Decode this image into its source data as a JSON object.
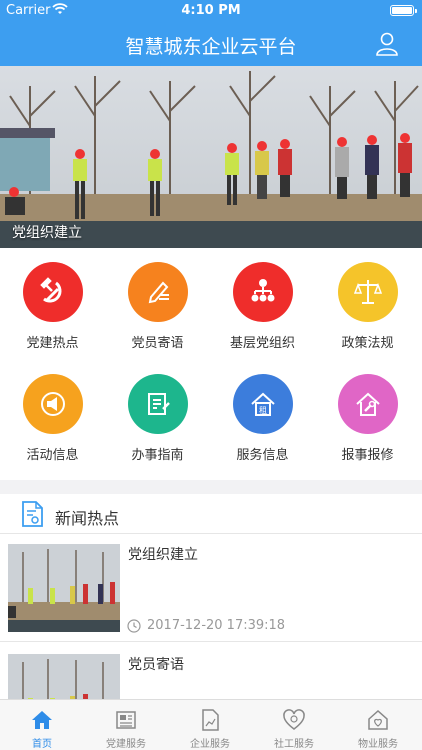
{
  "status_bar": {
    "carrier": "Carrier",
    "time": "4:10 PM"
  },
  "nav": {
    "title": "智慧城东企业云平台",
    "user_icon": "user-icon"
  },
  "banner": {
    "caption": "党组织建立"
  },
  "grid": {
    "items": [
      {
        "label": "党建热点",
        "icon": "hammer-sickle-icon",
        "color": "#ef2d2b"
      },
      {
        "label": "党员寄语",
        "icon": "pen-note-icon",
        "color": "#f6821e"
      },
      {
        "label": "基层党组织",
        "icon": "org-chart-icon",
        "color": "#ef2d2b"
      },
      {
        "label": "政策法规",
        "icon": "scales-icon",
        "color": "#f5c42a"
      },
      {
        "label": "活动信息",
        "icon": "megaphone-icon",
        "color": "#f6a21e"
      },
      {
        "label": "办事指南",
        "icon": "guide-icon",
        "color": "#1db68d"
      },
      {
        "label": "服务信息",
        "icon": "rent-house-icon",
        "color": "#3c7ddc"
      },
      {
        "label": "报事报修",
        "icon": "repair-house-icon",
        "color": "#e066c6"
      }
    ]
  },
  "news": {
    "header": "新闻热点",
    "items": [
      {
        "title": "党组织建立",
        "time": "2017-12-20 17:39:18"
      },
      {
        "title": "党员寄语",
        "time": ""
      }
    ]
  },
  "tabs": [
    {
      "label": "首页",
      "icon": "home-icon",
      "active": true
    },
    {
      "label": "党建服务",
      "icon": "newspaper-icon",
      "active": false
    },
    {
      "label": "企业服务",
      "icon": "document-chart-icon",
      "active": false
    },
    {
      "label": "社工服务",
      "icon": "heart-hands-icon",
      "active": false
    },
    {
      "label": "物业服务",
      "icon": "house-heart-icon",
      "active": false
    }
  ],
  "colors": {
    "primary": "#3d9ef0",
    "tab_active": "#2e8ce8"
  }
}
